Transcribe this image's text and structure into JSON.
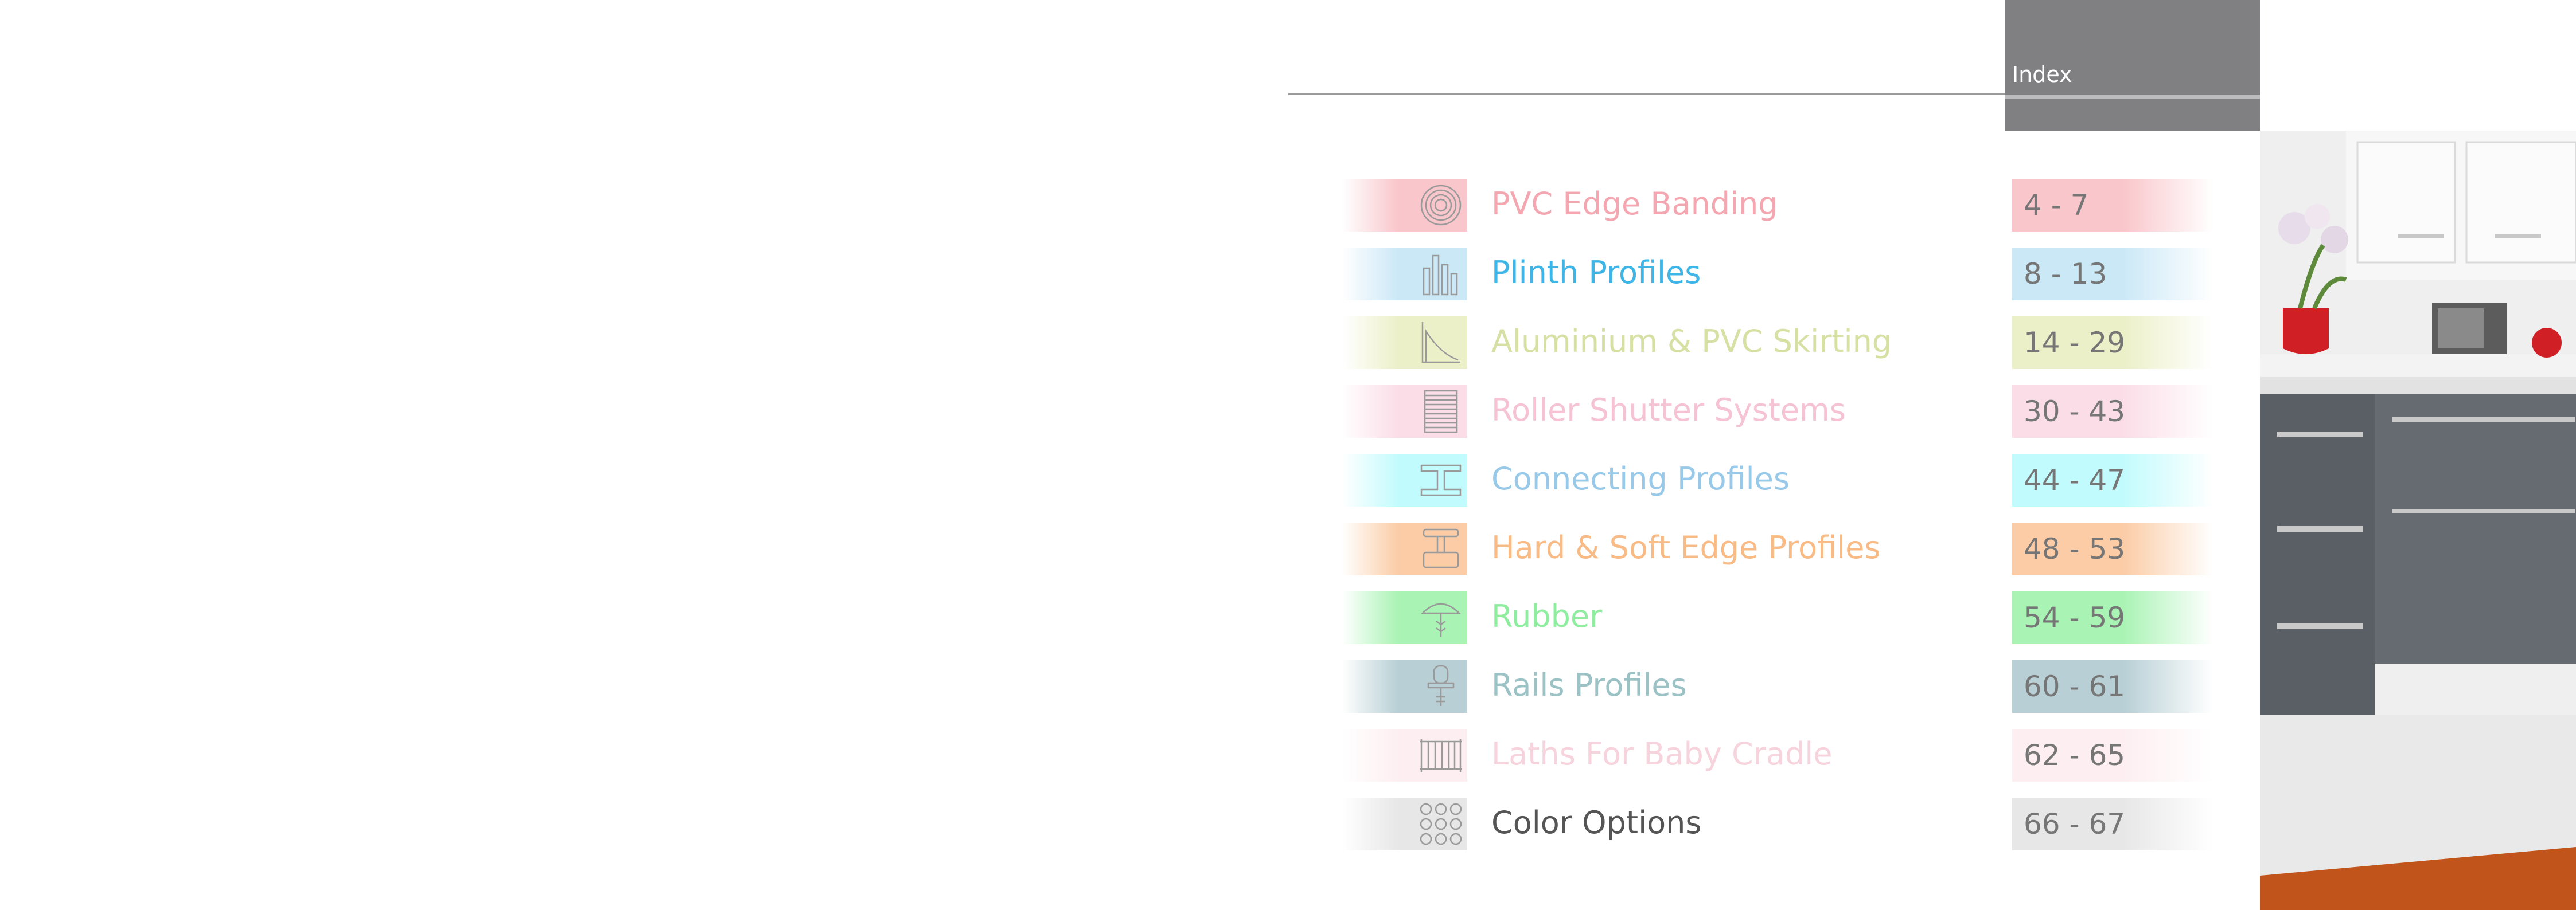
{
  "header": {
    "title": "Index"
  },
  "rows": [
    {
      "label": "PVC Edge Banding",
      "pages": "4 - 7",
      "color": "#f4a7b0",
      "tint": "#f9c6cb",
      "icon": "edge-banding-roll-icon"
    },
    {
      "label": "Plinth Profiles",
      "pages": "8 - 13",
      "color": "#3eb5e7",
      "tint": "#cbe8f7",
      "icon": "plinth-profiles-icon"
    },
    {
      "label": "Aluminium & PVC Skirting",
      "pages": "14 - 29",
      "color": "#d5e0a2",
      "tint": "#ecf0c8",
      "icon": "skirting-profile-icon"
    },
    {
      "label": "Roller Shutter Systems",
      "pages": "30 - 43",
      "color": "#f5c3d3",
      "tint": "#fbdde7",
      "icon": "roller-shutter-icon"
    },
    {
      "label": "Connecting Profiles",
      "pages": "44 - 47",
      "color": "#98c9e8",
      "tint": "#c2fbfd",
      "icon": "connecting-profile-icon"
    },
    {
      "label": "Hard & Soft Edge Profiles",
      "pages": "48 - 53",
      "color": "#f8bb86",
      "tint": "#fbcca6",
      "icon": "edge-profile-icon"
    },
    {
      "label": "Rubber",
      "pages": "54 - 59",
      "color": "#8fed9f",
      "tint": "#a9f3b4",
      "icon": "rubber-profile-icon"
    },
    {
      "label": "Rails Profiles",
      "pages": "60 - 61",
      "color": "#9bc2c5",
      "tint": "#b7cfd5",
      "icon": "rails-profile-icon"
    },
    {
      "label": "Laths For Baby Cradle",
      "pages": "62 - 65",
      "color": "#f7d3dd",
      "tint": "#fdeff1",
      "icon": "baby-cradle-laths-icon"
    },
    {
      "label": "Color Options",
      "pages": "66 - 67",
      "color": "#555555",
      "tint": "#e7e7e7",
      "icon": "color-options-grid-icon"
    }
  ]
}
